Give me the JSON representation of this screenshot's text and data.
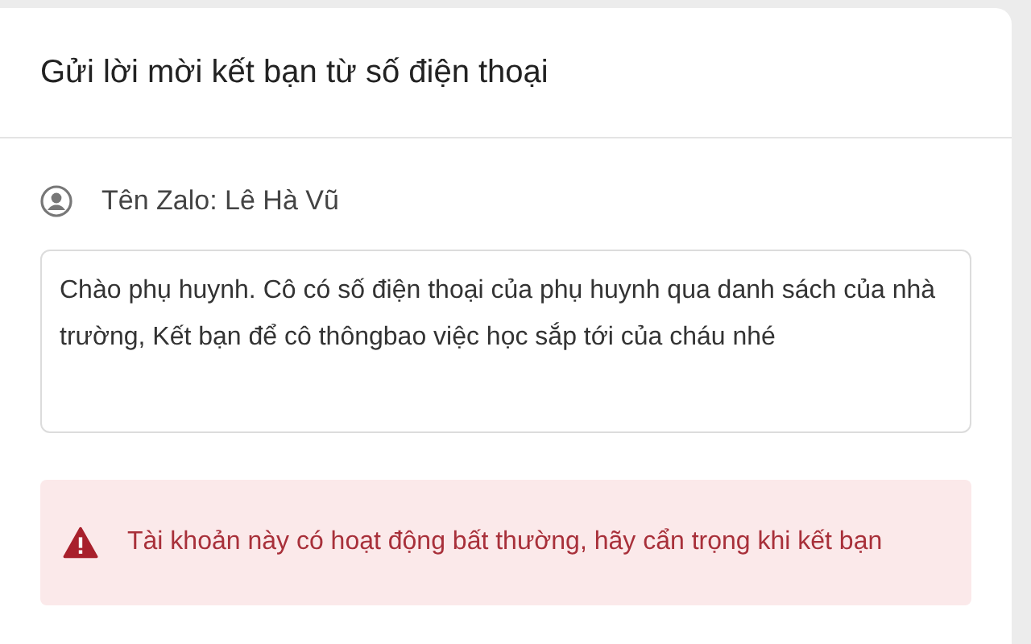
{
  "dialog": {
    "title": "Gửi lời mời kết bạn từ số điện thoại"
  },
  "contact": {
    "name_label": "Tên Zalo: Lê Hà Vũ"
  },
  "message": {
    "value": "Chào phụ huynh. Cô có số điện thoại của phụ huynh qua danh sách của nhà trường, Kết bạn để cô thôngbao việc học sắp tới của cháu nhé"
  },
  "warning": {
    "text": "Tài khoản này có hoạt động bất thường, hãy cẩn trọng khi kết bạn"
  }
}
